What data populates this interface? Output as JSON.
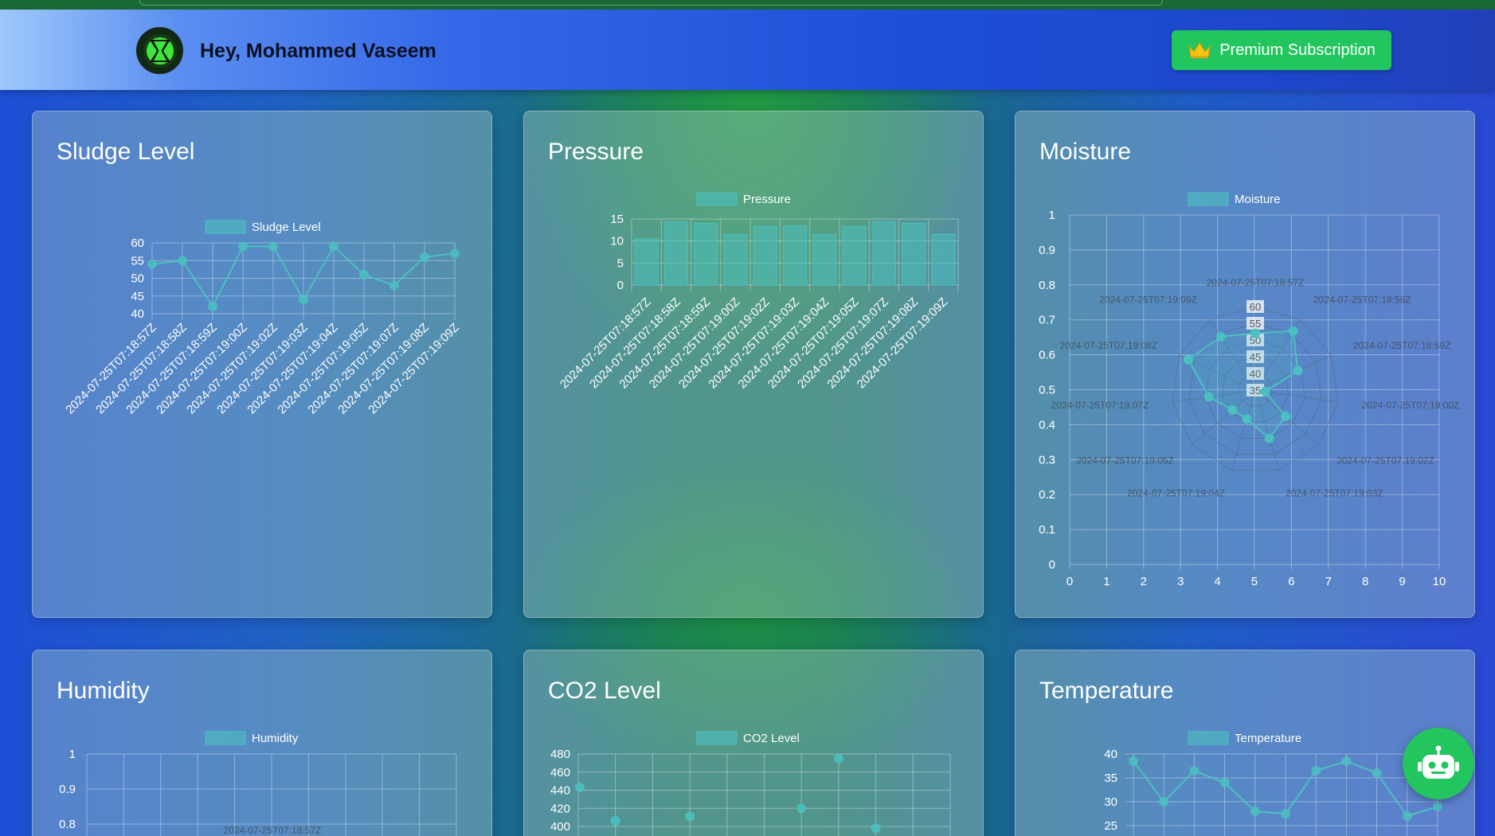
{
  "header": {
    "greeting": "Hey, Mohammed Vaseem",
    "premium_label": "Premium Subscription",
    "avatar_icon": "omnitrix-icon",
    "premium_icon": "crown-icon"
  },
  "colors": {
    "accent_green": "#22c55e",
    "series": "#4bc0c0",
    "header_start": "#9ec8fb",
    "header_end": "#2140b8"
  },
  "cards": {
    "sludge": {
      "title": "Sludge Level"
    },
    "pressure": {
      "title": "Pressure"
    },
    "moisture": {
      "title": "Moisture"
    },
    "humidity": {
      "title": "Humidity"
    },
    "co2": {
      "title": "CO2 Level"
    },
    "temperature": {
      "title": "Temperature"
    }
  },
  "chatbot_icon": "robot-icon",
  "chart_data": [
    {
      "id": "sludge",
      "type": "line",
      "title": "Sludge Level",
      "legend": "Sludge Level",
      "categories": [
        "2024-07-25T07:18:57Z",
        "2024-07-25T07:18:58Z",
        "2024-07-25T07:18:59Z",
        "2024-07-25T07:19:00Z",
        "2024-07-25T07:19:02Z",
        "2024-07-25T07:19:03Z",
        "2024-07-25T07:19:04Z",
        "2024-07-25T07:19:05Z",
        "2024-07-25T07:19:07Z",
        "2024-07-25T07:19:08Z",
        "2024-07-25T07:19:09Z"
      ],
      "values": [
        54,
        55,
        42,
        59,
        59,
        44,
        59,
        51,
        48,
        56,
        57
      ],
      "ylim": [
        40,
        60
      ],
      "yticks": [
        40,
        45,
        50,
        55,
        60
      ]
    },
    {
      "id": "pressure",
      "type": "bar",
      "title": "Pressure",
      "legend": "Pressure",
      "categories": [
        "2024-07-25T07:18:57Z",
        "2024-07-25T07:18:58Z",
        "2024-07-25T07:18:59Z",
        "2024-07-25T07:19:00Z",
        "2024-07-25T07:19:02Z",
        "2024-07-25T07:19:03Z",
        "2024-07-25T07:19:04Z",
        "2024-07-25T07:19:05Z",
        "2024-07-25T07:19:07Z",
        "2024-07-25T07:19:08Z",
        "2024-07-25T07:19:09Z"
      ],
      "values": [
        10.5,
        14.3,
        14,
        11.5,
        13.3,
        13.4,
        11.5,
        13.3,
        14.4,
        14,
        11.5
      ],
      "ylim": [
        0,
        15
      ],
      "yticks": [
        0,
        5,
        10,
        15
      ]
    },
    {
      "id": "moisture",
      "type": "radar",
      "title": "Moisture",
      "legend": "Moisture",
      "categories": [
        "2024-07-25T07:18:57Z",
        "2024-07-25T07:18:58Z",
        "2024-07-25T07:18:59Z",
        "2024-07-25T07:19:00Z",
        "2024-07-25T07:19:02Z",
        "2024-07-25T07:19:03Z",
        "2024-07-25T07:19:04Z",
        "2024-07-25T07:19:05Z",
        "2024-07-25T07:19:07Z",
        "2024-07-25T07:19:08Z",
        "2024-07-25T07:19:09Z"
      ],
      "values": [
        52,
        56,
        49,
        38,
        47,
        50,
        44,
        44,
        49,
        57,
        54
      ],
      "radial_ticks": [
        35,
        40,
        45,
        50,
        55,
        60
      ],
      "x_ticks": [
        0,
        1,
        2,
        3,
        4,
        5,
        6,
        7,
        8,
        9,
        10
      ],
      "y_ticks": [
        0,
        0.1,
        0.2,
        0.3,
        0.4,
        0.5,
        0.6,
        0.7,
        0.8,
        0.9,
        1
      ]
    },
    {
      "id": "humidity",
      "type": "radar",
      "title": "Humidity",
      "legend": "Humidity",
      "y_ticks_visible": [
        1,
        0.9,
        0.8
      ],
      "top_label": "2024-07-25T07:18:57Z"
    },
    {
      "id": "co2",
      "type": "scatter",
      "title": "CO2 Level",
      "legend": "CO2 Level",
      "values": [
        443,
        406,
        411,
        475,
        420,
        398
      ],
      "x_index": [
        0,
        1,
        3,
        7,
        6,
        8
      ],
      "yticks_visible": [
        400,
        420,
        440,
        460,
        480
      ]
    },
    {
      "id": "temperature",
      "type": "line",
      "title": "Temperature",
      "legend": "Temperature",
      "values": [
        38.5,
        30,
        36.5,
        34,
        28,
        27.5,
        36.5,
        38.5,
        36,
        27,
        29
      ],
      "yticks_visible": [
        25,
        30,
        35,
        40
      ]
    }
  ]
}
